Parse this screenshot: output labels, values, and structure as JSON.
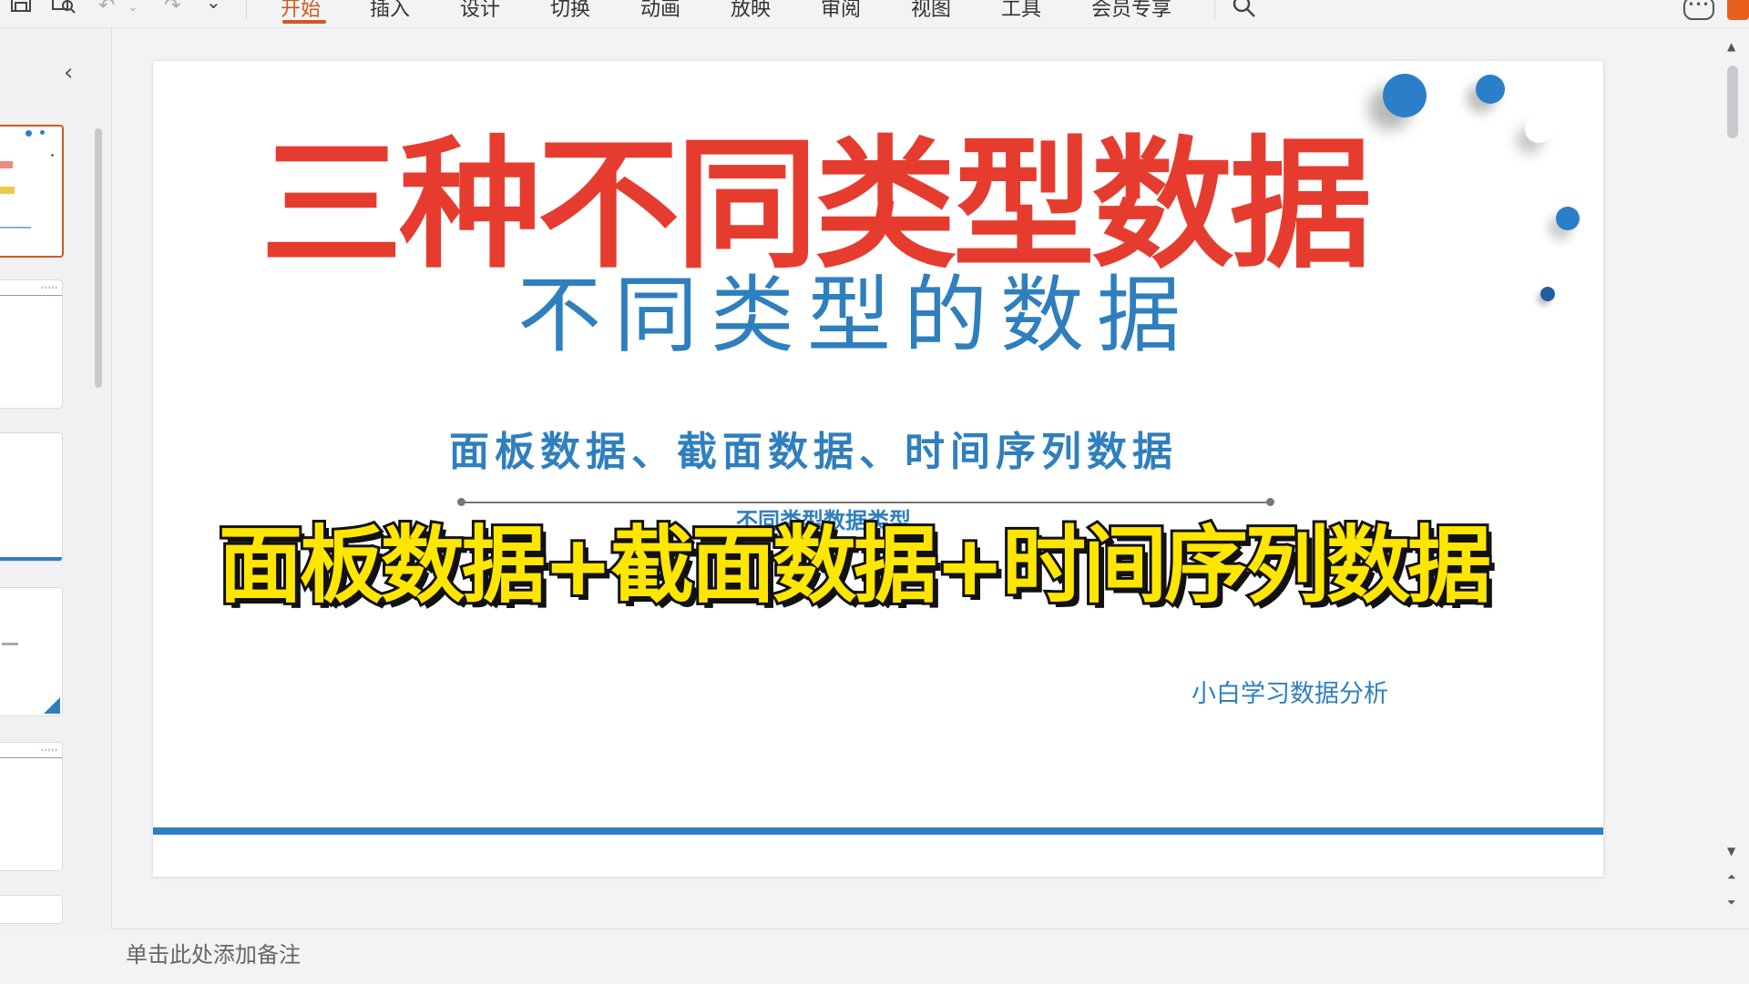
{
  "ribbon": {
    "tabs": [
      {
        "label": "开始",
        "active": true
      },
      {
        "label": "插入"
      },
      {
        "label": "设计"
      },
      {
        "label": "切换"
      },
      {
        "label": "动画"
      },
      {
        "label": "放映"
      },
      {
        "label": "审阅"
      },
      {
        "label": "视图"
      },
      {
        "label": "工具"
      },
      {
        "label": "会员专享"
      }
    ],
    "accent_color": "#d2581f",
    "icons": [
      "save-icon",
      "print-preview-icon",
      "undo-icon",
      "redo-icon",
      "customize-dropdown-icon",
      "search-icon",
      "chat-icon"
    ]
  },
  "slide": {
    "title_red": "三种不同类型数据",
    "title_blue": "不同类型的数据",
    "subtitle": "面板数据、截面数据、时间序列数据",
    "overlay_partial": "不同类型数据类型",
    "banner_yellow": "面板数据+截面数据+时间序列数据",
    "author": "小白学习数据分析",
    "colors": {
      "red": "#e63c2f",
      "blue": "#2f7fbe",
      "yellow": "#ffe600"
    }
  },
  "notes": {
    "placeholder": "单击此处添加备注"
  }
}
